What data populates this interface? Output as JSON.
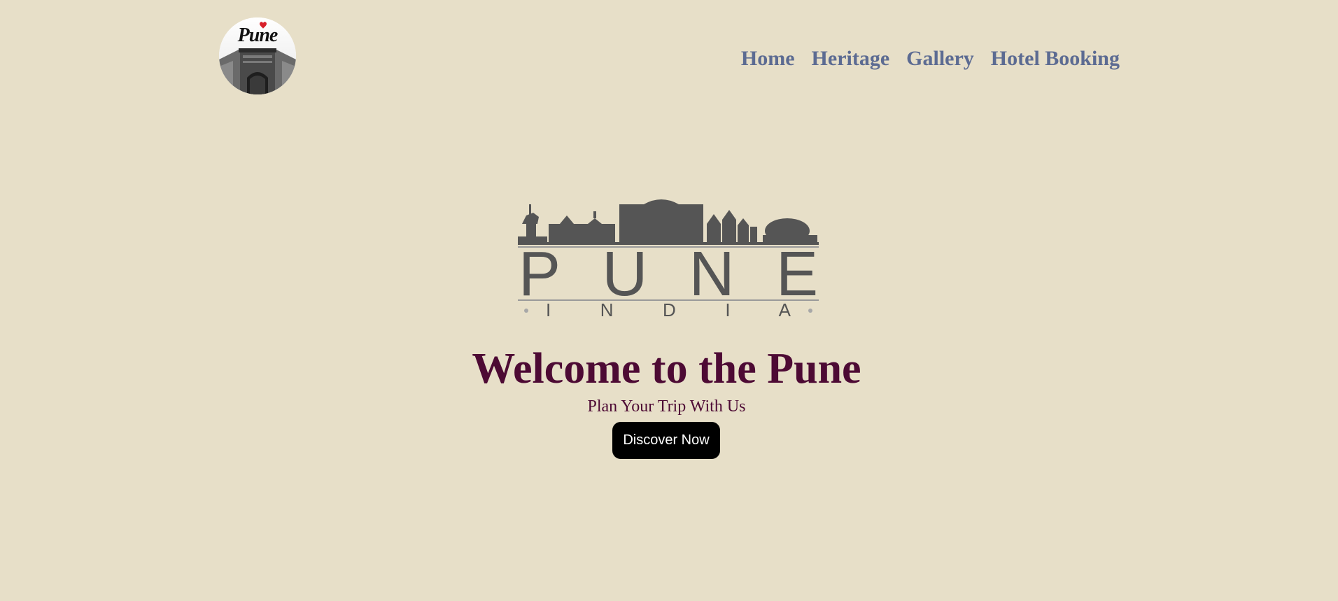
{
  "header": {
    "logo_text": "Pune",
    "nav": [
      {
        "label": "Home"
      },
      {
        "label": "Heritage"
      },
      {
        "label": "Gallery"
      },
      {
        "label": "Hotel Booking"
      }
    ]
  },
  "hero": {
    "emblem_word": "PUNE",
    "emblem_subword": "I N D I A",
    "title": "Welcome to the Pune",
    "subtitle": "Plan Your Trip With Us",
    "cta_label": "Discover Now"
  },
  "colors": {
    "background": "#e7dfc8",
    "nav_link": "#5c6b92",
    "heading": "#4d0a34",
    "button_bg": "#000000",
    "button_text": "#ffffff",
    "emblem_gray": "#555555",
    "logo_heart": "#d8202a"
  }
}
